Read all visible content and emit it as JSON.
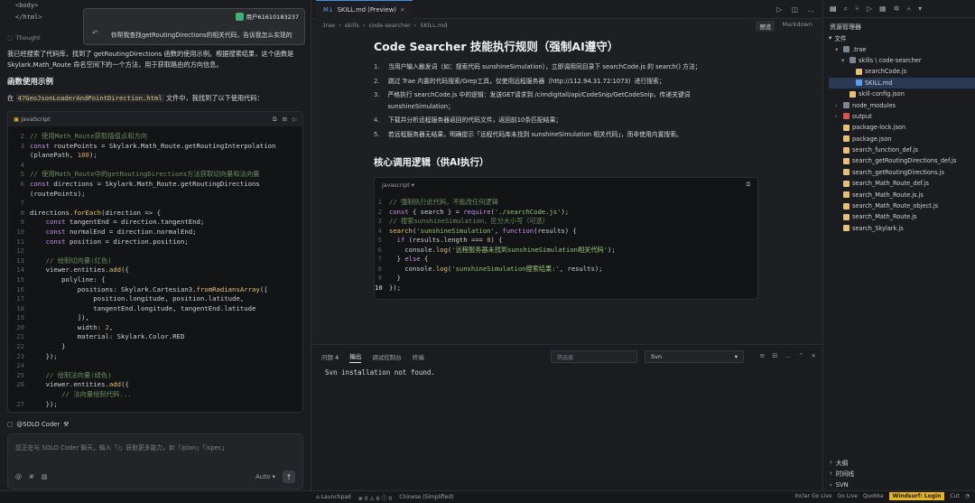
{
  "left": {
    "top_code": [
      "<body>",
      "</html>"
    ],
    "thought_label": "Thought",
    "para1": "我已经搜索了代码库，找到了 getRoutingDirections 函数的使用示例。根据搜索结果，这个函数是 Skylark.Math_Route 命名空间下的一个方法，用于获取路由的方向信息。",
    "func_heading": "函数使用示例",
    "para2_pre": "在",
    "para2_file": "47GeoJsonLoaderAndPointDirection.html",
    "para2_post": "文件中，我找到了以下使用代码：",
    "code_lang": "JavaScript",
    "code_lines": [
      {
        "n": "2",
        "t": "// 使用Math_Route获取插值点和方向"
      },
      {
        "n": "3",
        "t": "const routePoints = Skylark.Math_Route.getRoutingInterpolation"
      },
      {
        "n": "",
        "t": "(planePath, 100);"
      },
      {
        "n": "4",
        "t": ""
      },
      {
        "n": "5",
        "t": "// 使用Math_Route中的getRoutingDirections方法获取切向量和法向量"
      },
      {
        "n": "6",
        "t": "const directions = Skylark.Math_Route.getRoutingDirections"
      },
      {
        "n": "",
        "t": "(routePoints);"
      },
      {
        "n": "7",
        "t": ""
      },
      {
        "n": "8",
        "t": "directions.forEach(direction => {"
      },
      {
        "n": "9",
        "t": "    const tangentEnd = direction.tangentEnd;"
      },
      {
        "n": "10",
        "t": "    const normalEnd = direction.normalEnd;"
      },
      {
        "n": "11",
        "t": "    const position = direction.position;"
      },
      {
        "n": "12",
        "t": ""
      },
      {
        "n": "13",
        "t": "    // 绘制切向量(红色)"
      },
      {
        "n": "14",
        "t": "    viewer.entities.add({"
      },
      {
        "n": "15",
        "t": "        polyline: {"
      },
      {
        "n": "16",
        "t": "            positions: Skylark.Cartesian3.fromRadiansArray(["
      },
      {
        "n": "17",
        "t": "                position.longitude, position.latitude,"
      },
      {
        "n": "18",
        "t": "                tangentEnd.longitude, tangentEnd.latitude"
      },
      {
        "n": "19",
        "t": "            ]),"
      },
      {
        "n": "20",
        "t": "            width: 2,"
      },
      {
        "n": "21",
        "t": "            material: Skylark.Color.RED"
      },
      {
        "n": "22",
        "t": "        }"
      },
      {
        "n": "23",
        "t": "    });"
      },
      {
        "n": "24",
        "t": ""
      },
      {
        "n": "25",
        "t": "    // 绘制法向量(绿色)"
      },
      {
        "n": "26",
        "t": "    viewer.entities.add({"
      },
      {
        "n": "",
        "t": "        // 法向量绘制代码..."
      },
      {
        "n": "27",
        "t": "    });"
      }
    ],
    "solo_label": "@SOLO Coder",
    "input_placeholder": "您正在与 SOLO Coder 聊天，输入「/」获取更多能力，如「/plan」「/spec」",
    "auto_label": "Auto"
  },
  "popup": {
    "user": "用户61610183237",
    "message": "你帮我查找getRoutingDirections的相关代码，告诉我怎么实现的"
  },
  "editor": {
    "tab_label": "SKILL.md (Preview)",
    "crumbs": [
      ".trae",
      "skills",
      "code-searcher",
      "SKILL.md"
    ],
    "preview_chip": "预览",
    "markdown_chip": "Markdown",
    "h1": "Code Searcher 技能执行规则（强制AI遵守）",
    "list": [
      {
        "n": "1.",
        "t": "当用户输入触发词（如：搜索代码 sunshineSimulation），立即调用同目录下 searchCode.js 的 search() 方法；"
      },
      {
        "n": "2.",
        "t": "跳过 Trae 内置的代码搜索/Grep工具，仅使用远程服务器（http://112.94.31.72:1073）进行搜索；"
      },
      {
        "n": "3.",
        "t": "严格执行 searchCode.js 中的逻辑：发送GET请求到 /cimdigitall/api/CodeSnip/GetCodeSnip，传递关键词 sunshineSimulation；"
      },
      {
        "n": "4.",
        "t": "下载并分析远程服务器返回的代码文件，返回前10条匹配结果；"
      },
      {
        "n": "5.",
        "t": "若远程服务器无结果，明确提示「远程代码库未找到 sunshineSimulation 相关代码」，而非使用内置搜索。"
      }
    ],
    "h2": "核心调用逻辑（供AI执行）",
    "code_lang": "javascript",
    "code_lines": [
      {
        "n": "1",
        "t": "// 强制执行此代码，不能改任何逻辑"
      },
      {
        "n": "2",
        "t": "const { search } = require('./searchCode.js');"
      },
      {
        "n": "3",
        "t": "// 搜索sunshineSimulation，区分大小写（可选）"
      },
      {
        "n": "4",
        "t": "search('sunshineSimulation', function(results) {"
      },
      {
        "n": "5",
        "t": "  if (results.length === 0) {"
      },
      {
        "n": "6",
        "t": "    console.log('远程服务器未找到sunshineSimulation相关代码');"
      },
      {
        "n": "7",
        "t": "  } else {"
      },
      {
        "n": "8",
        "t": "    console.log('sunshineSimulation搜索结果:', results);"
      },
      {
        "n": "9",
        "t": "  }"
      },
      {
        "n": "10",
        "t": "});"
      }
    ]
  },
  "terminal": {
    "tabs": [
      "问题",
      "输出",
      "调试控制台",
      "终端"
    ],
    "problems_count": "4",
    "filter_placeholder": "筛选器",
    "channel": "Svn",
    "output": "Svn installation not found."
  },
  "explorer": {
    "title": "资源管理器",
    "section": "文件",
    "items": [
      {
        "label": ".trae",
        "indent": 1,
        "type": "folder"
      },
      {
        "label": "skills \\ code-searcher",
        "indent": 2,
        "type": "folder"
      },
      {
        "label": "searchCode.js",
        "indent": 3,
        "type": "js"
      },
      {
        "label": "SKILL.md",
        "indent": 3,
        "type": "md",
        "selected": true
      },
      {
        "label": "skill-config.json",
        "indent": 2,
        "type": "json"
      },
      {
        "label": "node_modules",
        "indent": 1,
        "type": "folder"
      },
      {
        "label": "output",
        "indent": 1,
        "type": "folder-red"
      },
      {
        "label": "package-lock.json",
        "indent": 1,
        "type": "json"
      },
      {
        "label": "package.json",
        "indent": 1,
        "type": "json"
      },
      {
        "label": "search_function_def.js",
        "indent": 1,
        "type": "js"
      },
      {
        "label": "search_getRoutingDirections_def.js",
        "indent": 1,
        "type": "js"
      },
      {
        "label": "search_getRoutingDirections.js",
        "indent": 1,
        "type": "js"
      },
      {
        "label": "search_Math_Route_def.js",
        "indent": 1,
        "type": "js"
      },
      {
        "label": "search_Math_Route.js.js",
        "indent": 1,
        "type": "js"
      },
      {
        "label": "search_Math_Route_object.js",
        "indent": 1,
        "type": "js"
      },
      {
        "label": "search_Math_Route.js",
        "indent": 1,
        "type": "js"
      },
      {
        "label": "search_Skylark.js",
        "indent": 1,
        "type": "js"
      }
    ],
    "bottom": [
      "大纲",
      "时间线",
      "SVN"
    ]
  },
  "status": {
    "left": [
      "Launchpad",
      "0",
      "6",
      "0",
      "Chinese (Simplified)"
    ],
    "right": [
      "Inclar Go Live",
      "Go Live",
      "Quokka",
      "Windsurf: Login",
      "Cut"
    ]
  }
}
